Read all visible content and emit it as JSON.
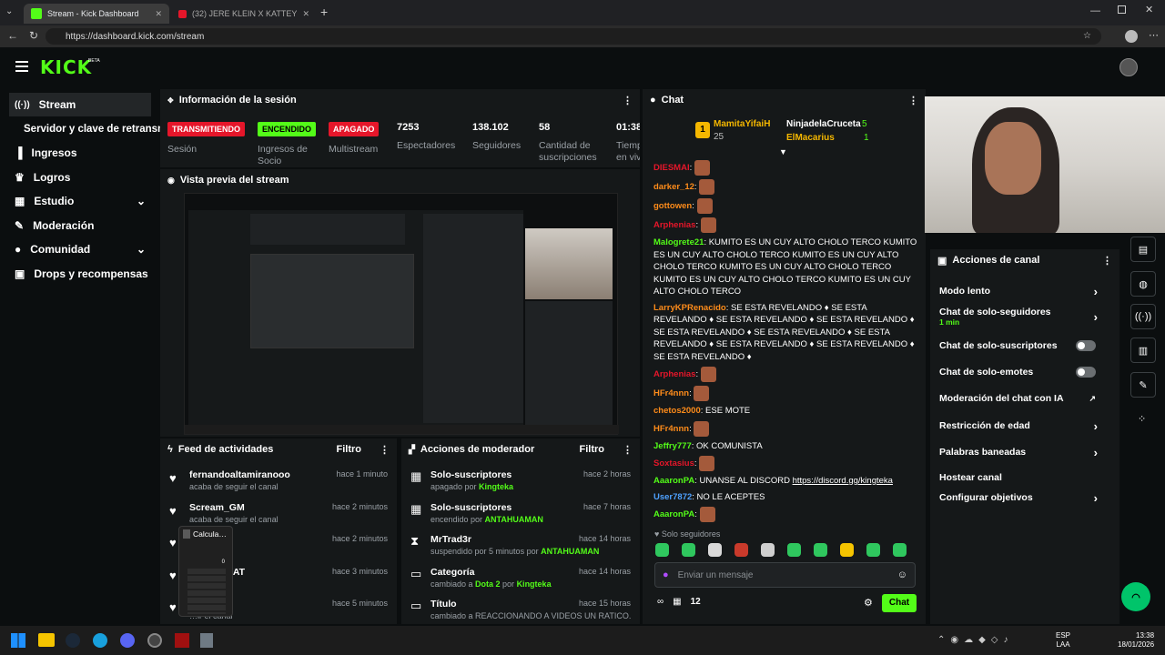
{
  "browser": {
    "tabs": [
      {
        "title": "Stream - Kick Dashboard"
      },
      {
        "title": "(32) JERE KLEIN X KATTEYES - TOC"
      }
    ],
    "url": "https://dashboard.kick.com/stream"
  },
  "brand": {
    "logo": "KICK",
    "beta": "BETA",
    "accent": "#53fc18"
  },
  "sidebar": {
    "items": [
      {
        "label": "Stream",
        "icon": "stream-icon"
      },
      {
        "label": "Servidor y clave de retransmisión"
      },
      {
        "label": "Ingresos",
        "icon": "bar-chart-icon"
      },
      {
        "label": "Logros",
        "icon": "trophy-icon"
      },
      {
        "label": "Estudio",
        "icon": "studio-icon"
      },
      {
        "label": "Moderación",
        "icon": "wrench-icon"
      },
      {
        "label": "Comunidad",
        "icon": "users-icon"
      },
      {
        "label": "Drops y recompensas",
        "icon": "gift-icon"
      }
    ]
  },
  "session": {
    "title": "Información de la sesión",
    "stats": [
      {
        "value": "TRANSMITIENDO",
        "label": "Sesión",
        "badge_color": "#e5162a"
      },
      {
        "value": "ENCENDIDO",
        "label": "Ingresos de Socio",
        "badge_color": "#53fc18"
      },
      {
        "value": "APAGADO",
        "label": "Multistream",
        "badge_color": "#e5162a"
      },
      {
        "value": "7253",
        "label": "Espectadores"
      },
      {
        "value": "138.102",
        "label": "Seguidores"
      },
      {
        "value": "58",
        "label": "Cantidad de suscripciones"
      },
      {
        "value": "01:38",
        "label": "Tiempo en vivo"
      }
    ]
  },
  "preview": {
    "title": "Vista previa del stream"
  },
  "feed": {
    "title": "Feed de actividades",
    "filter": "Filtro",
    "rows": [
      {
        "name": "fernandoaltamiranooo",
        "desc": "acaba de seguir el canal",
        "time": "hace 1 minuto"
      },
      {
        "name": "Scream_GM",
        "desc": "acaba de seguir el canal",
        "time": "hace 2 minutos"
      },
      {
        "name": "…idad",
        "desc": "…ir el canal",
        "time": "hace 2 minutos"
      },
      {
        "name": "…THEGOAT",
        "desc": "…ir el canal",
        "time": "hace 3 minutos"
      },
      {
        "name": "…R3000",
        "desc": "…ir el canal",
        "time": "hace 5 minutos"
      }
    ]
  },
  "calculator": {
    "title": "Calcula…",
    "display": "0"
  },
  "modactions": {
    "title": "Acciones de moderador",
    "filter": "Filtro",
    "rows": [
      {
        "name": "Solo-suscriptores",
        "desc": "apagado por ",
        "by": "Kingteka",
        "time": "hace 2 horas"
      },
      {
        "name": "Solo-suscriptores",
        "desc": "encendido por ",
        "by": "ANTAHUAMAN",
        "time": "hace 7 horas"
      },
      {
        "name": "MrTrad3r",
        "desc": "suspendido por 5 minutos por ",
        "by": "ANTAHUAMAN",
        "time": "hace 14 horas"
      },
      {
        "name": "Categoría",
        "desc": "cambiado a ",
        "by": "Dota 2",
        "desc2": " por ",
        "by2": "Kingteka",
        "time": "hace 14 horas"
      },
      {
        "name": "Título",
        "desc": "cambiado a REACCIONANDO A VIDEOS UN RATICO...",
        "by": "",
        "time": "hace 15 horas"
      }
    ]
  },
  "chat": {
    "title": "Chat",
    "leaderboard": {
      "rank": "1",
      "first": "MamitaYifaiH",
      "first_count": "25",
      "second": "NinjadelaCruceta",
      "second_count": "5",
      "third": "ElMacarius",
      "third_count": "1"
    },
    "messages": [
      {
        "user": "DIESMAI",
        "color": "#e5162a",
        "text": "",
        "emote": "wave"
      },
      {
        "user": "darker_12",
        "color": "#ff8c1a",
        "text": "",
        "emote": "face"
      },
      {
        "user": "gottowen",
        "color": "#ff8c1a",
        "text": "",
        "emote": "face"
      },
      {
        "user": "Arphenias",
        "color": "#e5162a",
        "text": "",
        "emote": "face"
      },
      {
        "user": "Malogrete21",
        "color": "#53fc18",
        "text": "KUMITO ES UN CUY ALTO CHOLO TERCO KUMITO ES UN CUY ALTO CHOLO TERCO KUMITO ES UN CUY ALTO CHOLO TERCO KUMITO ES UN CUY ALTO CHOLO TERCO KUMITO ES UN CUY ALTO CHOLO TERCO KUMITO ES UN CUY ALTO CHOLO TERCO"
      },
      {
        "user": "LarryKPRenacido",
        "color": "#ff8c1a",
        "text": "SE ESTA REVELANDO ♦ SE ESTA REVELANDO ♦ SE ESTA REVELANDO ♦ SE ESTA REVELANDO ♦ SE ESTA REVELANDO ♦ SE ESTA REVELANDO ♦ SE ESTA REVELANDO ♦ SE ESTA REVELANDO ♦ SE ESTA REVELANDO ♦ SE ESTA REVELANDO ♦"
      },
      {
        "user": "Arphenias",
        "color": "#e5162a",
        "text": "",
        "emote": "face"
      },
      {
        "user": "HFr4nnn",
        "color": "#ff8c1a",
        "text": "",
        "emote": "face"
      },
      {
        "user": "chetos2000",
        "color": "#ff8c1a",
        "text": "ESE MOTE"
      },
      {
        "user": "HFr4nnn",
        "color": "#ff8c1a",
        "text": "",
        "emote": "face"
      },
      {
        "user": "Jeffry777",
        "color": "#53fc18",
        "text": "OK COMUNISTA"
      },
      {
        "user": "Soxtasius",
        "color": "#e5162a",
        "text": "",
        "emote": "face"
      },
      {
        "user": "AaaronPA",
        "color": "#53fc18",
        "text": "UNANSE AL DISCORD ",
        "link": "https://discord.gg/kingteka"
      },
      {
        "user": "User7872",
        "color": "#4ea1ff",
        "text": "NO LE ACEPTES"
      },
      {
        "user": "AaaronPA",
        "color": "#53fc18",
        "text": "",
        "emote": "face"
      }
    ],
    "mode": "Solo seguidores",
    "placeholder": "Enviar un mensaje",
    "count": "12",
    "send": "Chat"
  },
  "channel_actions": {
    "title": "Acciones de canal",
    "items": [
      {
        "label": "Modo lento",
        "type": "chevron"
      },
      {
        "label": "Chat de solo-seguidores",
        "sub": "1 min",
        "type": "chevron"
      },
      {
        "label": "Chat de solo-suscriptores",
        "type": "toggle"
      },
      {
        "label": "Chat de solo-emotes",
        "type": "toggle"
      },
      {
        "label": "Moderación del chat con IA",
        "type": "external"
      },
      {
        "label": "Restricción de edad",
        "type": "chevron"
      },
      {
        "label": "Palabras baneadas",
        "type": "chevron"
      },
      {
        "label": "Hostear canal",
        "type": "none"
      },
      {
        "label": "Configurar objetivos",
        "type": "chevron"
      }
    ]
  },
  "taskbar": {
    "lang": "ESP",
    "lang2": "LAA",
    "time": "13:38",
    "date": "18/01/2026"
  }
}
